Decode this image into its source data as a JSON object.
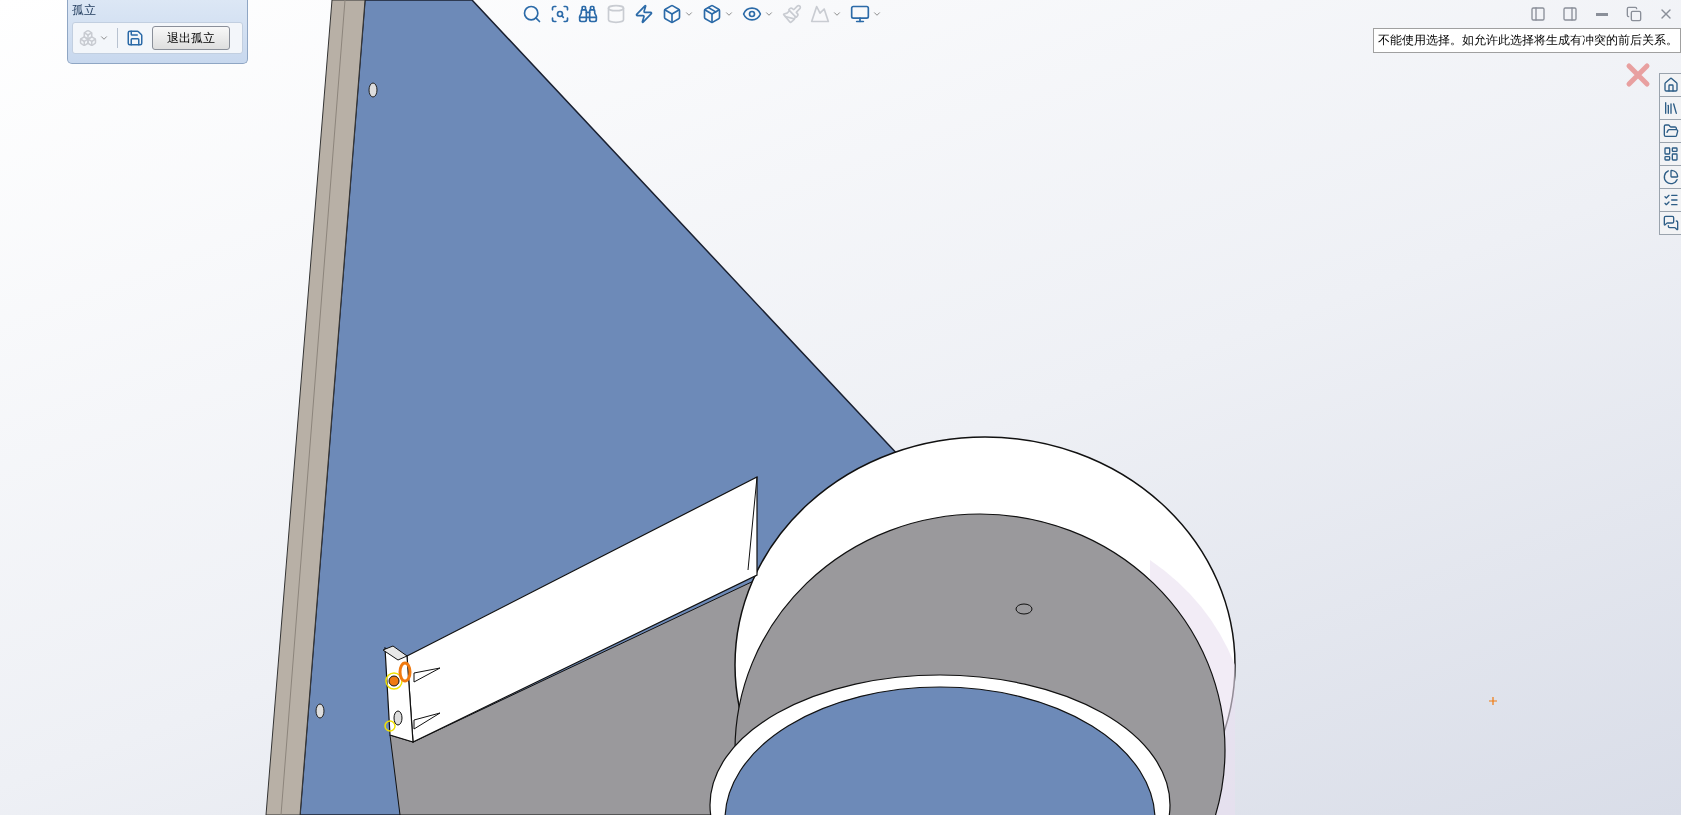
{
  "isolate_panel": {
    "title": "孤立",
    "tools": [
      {
        "kind": "component",
        "disabled": true,
        "dropdown": true
      },
      {
        "kind": "save",
        "disabled": false,
        "dropdown": false
      }
    ],
    "exit_button": "退出孤立"
  },
  "view_toolbar": [
    {
      "kind": "zoom-fit",
      "disabled": false,
      "dropdown": false
    },
    {
      "kind": "zoom-area",
      "disabled": false,
      "dropdown": false
    },
    {
      "kind": "previous-view",
      "disabled": false,
      "dropdown": false
    },
    {
      "kind": "section",
      "disabled": true,
      "dropdown": false
    },
    {
      "kind": "annotation",
      "disabled": false,
      "dropdown": false
    },
    {
      "kind": "orientation",
      "disabled": false,
      "dropdown": true
    },
    {
      "kind": "display-style",
      "disabled": false,
      "dropdown": true
    },
    {
      "kind": "hide-show",
      "disabled": false,
      "dropdown": true
    },
    {
      "kind": "appearance",
      "disabled": true,
      "dropdown": false
    },
    {
      "kind": "scene",
      "disabled": true,
      "dropdown": true
    },
    {
      "kind": "view-settings",
      "disabled": false,
      "dropdown": true
    }
  ],
  "window_controls": [
    {
      "kind": "prev"
    },
    {
      "kind": "next"
    },
    {
      "kind": "minimize"
    },
    {
      "kind": "restore"
    },
    {
      "kind": "close"
    }
  ],
  "tooltip": "不能使用选择。如允许此选择将生成有冲突的前后关系。",
  "task_pane": [
    {
      "kind": "home"
    },
    {
      "kind": "library"
    },
    {
      "kind": "folder"
    },
    {
      "kind": "properties"
    },
    {
      "kind": "appearance"
    },
    {
      "kind": "custom"
    },
    {
      "kind": "forum"
    }
  ]
}
